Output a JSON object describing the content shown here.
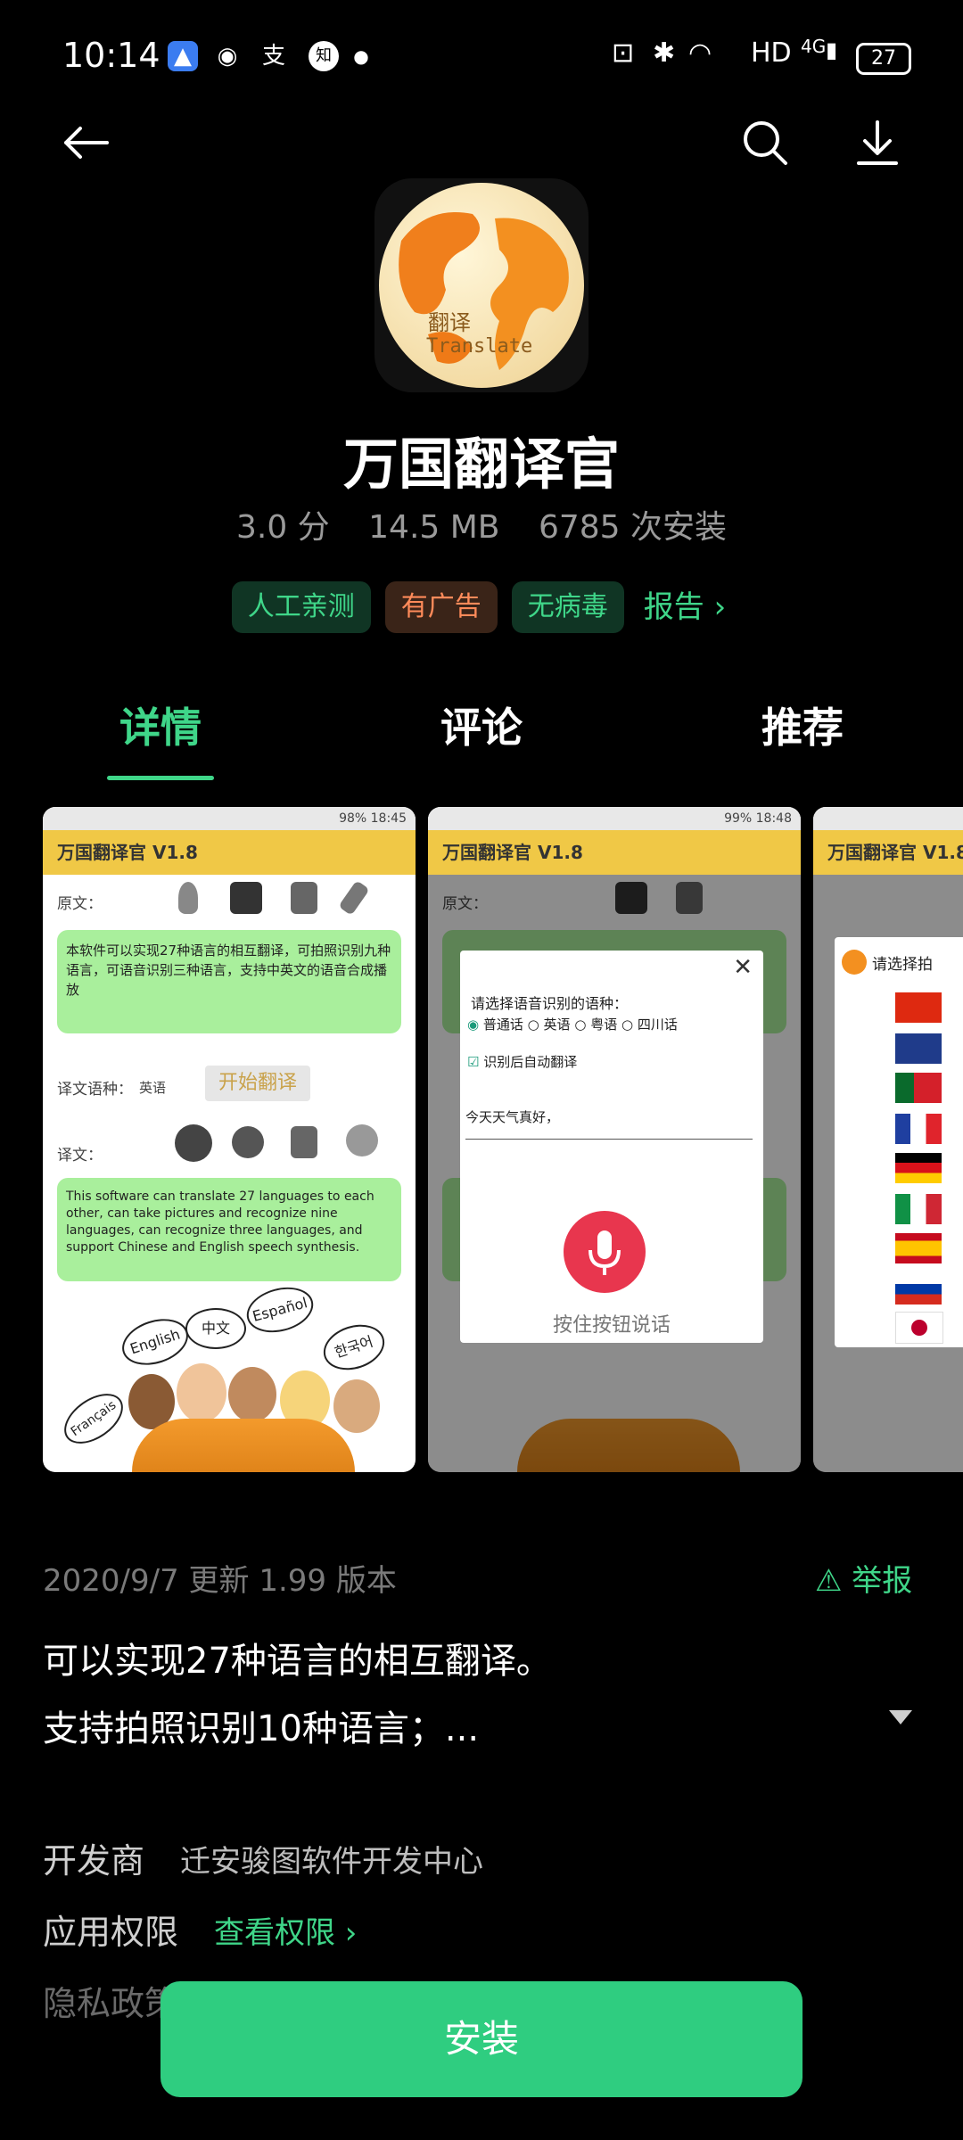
{
  "status_bar": {
    "time": "10:14",
    "network": "HD",
    "signal": "4G",
    "battery": "27"
  },
  "app": {
    "name": "万国翻译官",
    "rating": "3.0 分",
    "size": "14.5 MB",
    "installs": "6785 次安装",
    "icon_text_cn": "翻译",
    "icon_text_en": "Translate"
  },
  "tags": {
    "t1": "人工亲测",
    "t2": "有广告",
    "t3": "无病毒",
    "report": "报告 ›"
  },
  "tabs": {
    "details": "详情",
    "reviews": "评论",
    "recommend": "推荐"
  },
  "screenshots": {
    "s1": {
      "status": "98% 18:45",
      "title": "万国翻译官 V1.8",
      "source_label": "原文：",
      "source_text": "本软件可以实现27种语言的相互翻译，可拍照识别九种语言，可语音识别三种语言，支持中英文的语音合成播放",
      "start_button": "开始翻译",
      "target_lang_label": "译文语种：",
      "target_lang": "英语",
      "target_label": "译文：",
      "target_text": "This software can translate 27 languages to each other, can take pictures and recognize nine languages, can recognize three languages, and support Chinese and English speech synthesis.",
      "bubbles": [
        "English",
        "中文",
        "Español",
        "한국어",
        "Français"
      ]
    },
    "s2": {
      "status": "99% 18:48",
      "title": "万国翻译官 V1.8",
      "source_label": "原文：",
      "dialog_title": "请选择语音识别的语种：",
      "options": [
        "普通话",
        "英语",
        "粤语",
        "四川话"
      ],
      "auto_translate": "识别后自动翻译",
      "recognized": "今天天气真好，",
      "hold_to_speak": "按住按钮说话",
      "close": "✕"
    },
    "s3": {
      "title": "万国翻译官 V1.8",
      "dialog_title": "请选择拍"
    }
  },
  "update_info": "2020/9/7 更新  1.99 版本",
  "report_link": "举报",
  "description": {
    "line1": "可以实现27种语言的相互翻译。",
    "line2": "支持拍照识别10种语言；..."
  },
  "developer": {
    "label": "开发商",
    "value": "迁安骏图软件开发中心"
  },
  "permissions": {
    "label": "应用权限",
    "link": "查看权限 ›"
  },
  "privacy": {
    "label": "隐私政策"
  },
  "install_button": "安装"
}
